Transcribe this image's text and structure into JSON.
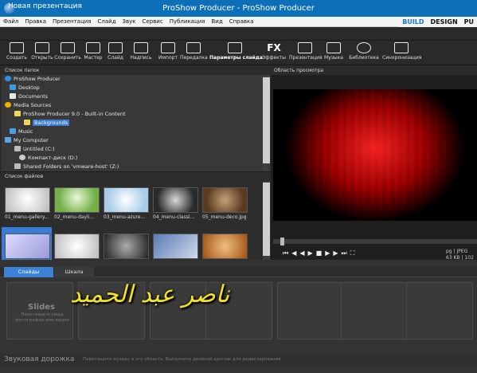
{
  "window": {
    "title": "ProShow Producer - ProShow Producer"
  },
  "menu": [
    "Файл",
    "Правка",
    "Презентация",
    "Слайд",
    "Звук",
    "Сервис",
    "Публикация",
    "Вид",
    "Справка"
  ],
  "modes": [
    "BUILD",
    "DESIGN",
    "PU"
  ],
  "project": {
    "title": "Новая презентация"
  },
  "toolbar": [
    {
      "label": "Создать",
      "icon": "new-icon"
    },
    {
      "label": "Открыть",
      "icon": "open-icon"
    },
    {
      "label": "Сохранить",
      "icon": "save-icon"
    },
    {
      "label": "Мастер",
      "icon": "wizard-icon"
    },
    {
      "label": "Слайд",
      "icon": "slide-icon"
    },
    {
      "label": "Надпись",
      "icon": "caption-icon"
    },
    {
      "label": "Импорт",
      "icon": "import-icon"
    },
    {
      "label": "Передалка",
      "icon": "remix-icon"
    },
    {
      "label": "Параметры слайда",
      "icon": "slide-options-icon"
    },
    {
      "label": "Эффекты",
      "icon": "fx-icon"
    },
    {
      "label": "Презентация",
      "icon": "show-icon"
    },
    {
      "label": "Музыка",
      "icon": "music-icon"
    },
    {
      "label": "Библиотека",
      "icon": "library-icon"
    },
    {
      "label": "Синхронизация",
      "icon": "sync-icon"
    }
  ],
  "folders": {
    "header": "Список папок",
    "items": [
      {
        "label": "ProShow Producer"
      },
      {
        "label": "Desktop"
      },
      {
        "label": "Documents"
      },
      {
        "label": "Media Sources"
      },
      {
        "label": "ProShow Producer 9.0 - Built-in Content"
      },
      {
        "label": "Backgrounds"
      },
      {
        "label": "Music"
      },
      {
        "label": "My Computer"
      },
      {
        "label": "Untitled (C:)"
      },
      {
        "label": "Компакт-диск (D:)"
      },
      {
        "label": "Shared Folders on 'vmware-host' (Z:)"
      }
    ]
  },
  "files": {
    "header": "Список файлов",
    "items": [
      {
        "label": "01_menu-gallery..."
      },
      {
        "label": "02_menu-dayli..."
      },
      {
        "label": "03_menu-azure..."
      },
      {
        "label": "04_menu-classi..."
      },
      {
        "label": "05_menu-deco.jpg"
      }
    ]
  },
  "preview": {
    "header": "Область просмотра",
    "file_info": "pg | JPEG",
    "file_size": "63 KB | 102"
  },
  "timeline": {
    "tab_slides": "Слайды",
    "tab_scale": "Шкала",
    "slides_title": "Slides",
    "slides_hint": "Перетащите сюда фотографии или видео",
    "audio_title": "Звуковая дорожка",
    "audio_hint": "Перетащите музыку в эту область. Выполните двойной щелчок для редактирования."
  },
  "overlay": {
    "text": "ناصر عبد الحميد"
  },
  "colors": {
    "titlebar": "#0d6fb8",
    "accent": "#3c82d6",
    "overlay": "#f2e22a"
  }
}
